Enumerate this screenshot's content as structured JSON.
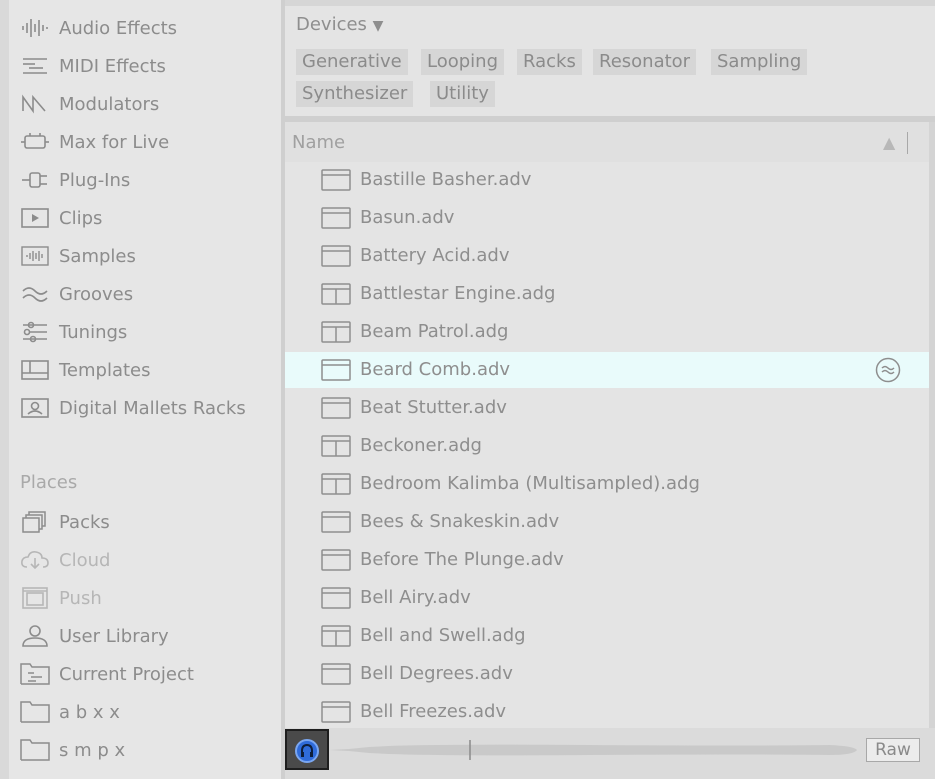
{
  "sidebar": {
    "categories": [
      {
        "label": "Audio Effects",
        "icon": "audio-effects-icon"
      },
      {
        "label": "MIDI Effects",
        "icon": "midi-effects-icon"
      },
      {
        "label": "Modulators",
        "icon": "modulators-icon"
      },
      {
        "label": "Max for Live",
        "icon": "max-for-live-icon"
      },
      {
        "label": "Plug-Ins",
        "icon": "plug-ins-icon"
      },
      {
        "label": "Clips",
        "icon": "clips-icon"
      },
      {
        "label": "Samples",
        "icon": "samples-icon"
      },
      {
        "label": "Grooves",
        "icon": "grooves-icon"
      },
      {
        "label": "Tunings",
        "icon": "tunings-icon"
      },
      {
        "label": "Templates",
        "icon": "templates-icon"
      },
      {
        "label": "Digital Mallets Racks",
        "icon": "collection-icon"
      }
    ],
    "places_header": "Places",
    "places": [
      {
        "label": "Packs",
        "icon": "packs-icon"
      },
      {
        "label": "Cloud",
        "icon": "cloud-icon"
      },
      {
        "label": "Push",
        "icon": "push-icon"
      },
      {
        "label": "User Library",
        "icon": "user-icon"
      },
      {
        "label": "Current Project",
        "icon": "project-folder-icon"
      },
      {
        "label": "a b x x",
        "icon": "folder-icon"
      },
      {
        "label": "s m p x",
        "icon": "folder-icon"
      }
    ]
  },
  "filter": {
    "title": "Devices",
    "title_arrow": "▼",
    "tags": [
      "Generative",
      "Looping",
      "Racks",
      "Resonator",
      "Sampling",
      "Synthesizer",
      "Utility"
    ]
  },
  "list": {
    "column_name": "Name",
    "sort_indicator": "▲",
    "rows": [
      {
        "label": "Bastille Basher.adv",
        "icon": "preset-icon"
      },
      {
        "label": "Basun.adv",
        "icon": "preset-icon"
      },
      {
        "label": "Battery Acid.adv",
        "icon": "preset-icon"
      },
      {
        "label": "Battlestar Engine.adg",
        "icon": "rack-icon"
      },
      {
        "label": "Beam Patrol.adg",
        "icon": "rack-icon"
      },
      {
        "label": "Beard Comb.adv",
        "icon": "preset-icon",
        "selected": true
      },
      {
        "label": "Beat Stutter.adv",
        "icon": "preset-icon"
      },
      {
        "label": "Beckoner.adg",
        "icon": "rack-icon"
      },
      {
        "label": "Bedroom Kalimba (Multisampled).adg",
        "icon": "rack-icon"
      },
      {
        "label": "Bees & Snakeskin.adv",
        "icon": "preset-icon"
      },
      {
        "label": "Before The Plunge.adv",
        "icon": "preset-icon"
      },
      {
        "label": "Bell Airy.adv",
        "icon": "preset-icon"
      },
      {
        "label": "Bell and Swell.adg",
        "icon": "rack-icon"
      },
      {
        "label": "Bell Degrees.adv",
        "icon": "preset-icon"
      },
      {
        "label": "Bell Freezes.adv",
        "icon": "preset-icon"
      }
    ]
  },
  "preview": {
    "raw_label": "Raw",
    "headphones_icon": "preview-headphones-icon",
    "accent_color": "#2f6bd9"
  }
}
